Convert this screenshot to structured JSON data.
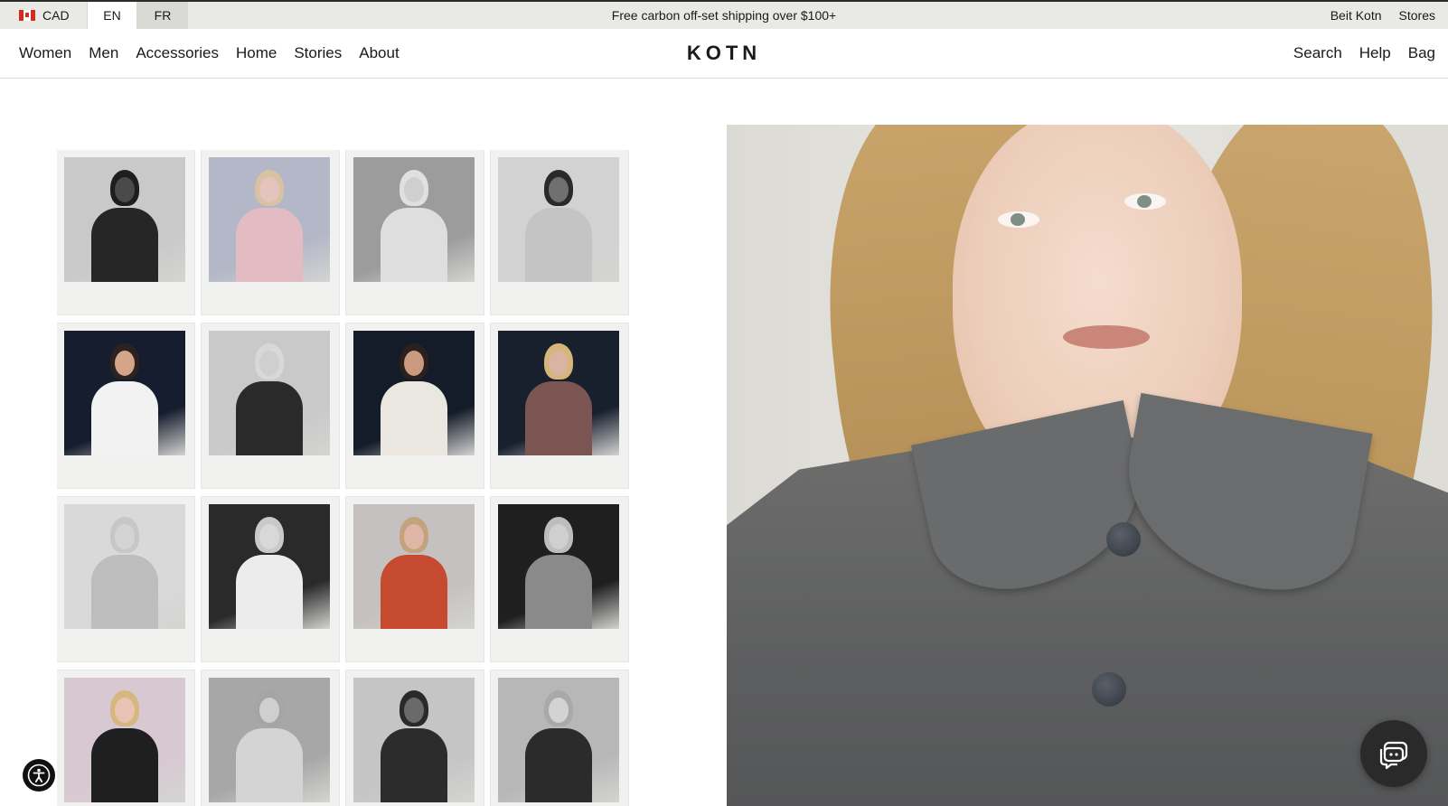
{
  "topbar": {
    "currency": "CAD",
    "languages": [
      {
        "label": "EN",
        "active": true
      },
      {
        "label": "FR",
        "active": false
      }
    ],
    "promo": "Free carbon off-set shipping over $100+",
    "links": [
      "Beit Kotn",
      "Stores"
    ]
  },
  "nav": {
    "left": [
      "Women",
      "Men",
      "Accessories",
      "Home",
      "Stories",
      "About"
    ],
    "logo": "KOTN",
    "right": [
      "Search",
      "Help",
      "Bag"
    ]
  },
  "icons": {
    "flag": "canada-flag-icon",
    "accessibility": "accessibility-icon",
    "chat": "chat-icon"
  },
  "colors": {
    "announcement_bg": "#e9e9e6",
    "text": "#1a1a1a",
    "coat": "#636465",
    "hair": "#c29e66"
  },
  "polaroids": [
    {
      "name": "polaroid-man-dark-jacket",
      "bg": "#c9c9c9",
      "skin": "#4a4a4a",
      "hair": "#1e1e1e",
      "top": "#262626"
    },
    {
      "name": "polaroid-woman-pink-top",
      "bg": "#b3b7c7",
      "skin": "#e5c4bd",
      "hair": "#d9c2a3",
      "top": "#e2bcc2"
    },
    {
      "name": "polaroid-woman-headscarf",
      "bg": "#9c9c9c",
      "skin": "#cfcfcf",
      "hair": "#e0e0e0",
      "top": "#dedede"
    },
    {
      "name": "polaroid-man-shirt-tie",
      "bg": "#d2d2d2",
      "skin": "#707070",
      "hair": "#2a2a2a",
      "top": "#c4c4c4"
    },
    {
      "name": "polaroid-man-striped-shirt",
      "bg": "#151d2e",
      "skin": "#d5a58a",
      "hair": "#2c2320",
      "top": "#f2f2f2"
    },
    {
      "name": "polaroid-woman-knit-top",
      "bg": "#c9c9c9",
      "skin": "#cfcfcf",
      "hair": "#d8d8d8",
      "top": "#2a2a2a"
    },
    {
      "name": "polaroid-man-white-tank",
      "bg": "#141c29",
      "skin": "#c99a80",
      "hair": "#2a201c",
      "top": "#eae6e0"
    },
    {
      "name": "polaroid-woman-brown-shirt",
      "bg": "#18202e",
      "skin": "#d8b4a1",
      "hair": "#d6b57a",
      "top": "#7a5552"
    },
    {
      "name": "polaroid-woman-two-tone-knit",
      "bg": "#d9d9d9",
      "skin": "#d4d4d4",
      "hair": "#c7c7c7",
      "top": "#bdbdbd"
    },
    {
      "name": "polaroid-woman-white-blouse",
      "bg": "#2a2a2a",
      "skin": "#d8d8d8",
      "hair": "#c9c9c9",
      "top": "#ececec"
    },
    {
      "name": "polaroid-woman-red-vest",
      "bg": "#c6c1c1",
      "skin": "#e0b7a6",
      "hair": "#c3a37d",
      "top": "#c64a2f"
    },
    {
      "name": "polaroid-woman-grey-sweater",
      "bg": "#1f1f1f",
      "skin": "#cfcfcf",
      "hair": "#bdbdbd",
      "top": "#8a8a8a"
    },
    {
      "name": "polaroid-woman-black-jacket",
      "bg": "#d8c8d2",
      "skin": "#e8c2b2",
      "hair": "#d6b780",
      "top": "#1f1f1f"
    },
    {
      "name": "polaroid-woman-back-view",
      "bg": "#a7a7a7",
      "skin": "#cfcfcf",
      "hair": "#a5a5a5",
      "top": "#d4d4d4"
    },
    {
      "name": "polaroid-man-vest",
      "bg": "#c5c5c5",
      "skin": "#6a6a6a",
      "hair": "#2a2a2a",
      "top": "#2c2c2c"
    },
    {
      "name": "polaroid-woman-dark-coat",
      "bg": "#b7b7b7",
      "skin": "#d3d3d3",
      "hair": "#a9a9a9",
      "top": "#2b2b2b"
    }
  ]
}
